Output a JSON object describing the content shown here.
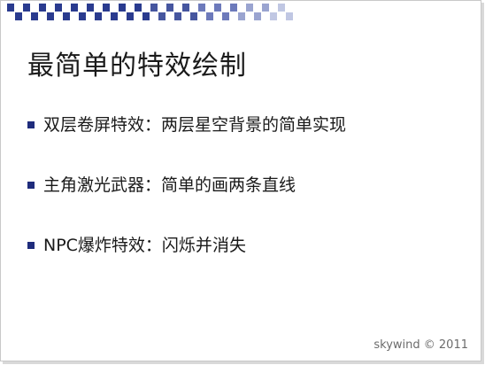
{
  "slide": {
    "title": "最简单的特效绘制",
    "bullets": [
      {
        "text": "双层卷屏特效：两层星空背景的简单实现"
      },
      {
        "text": "主角激光武器：简单的画两条直线"
      },
      {
        "text": "NPC爆炸特效：闪烁并消失"
      }
    ],
    "watermark": "skywind © 2011"
  },
  "colors": {
    "bullet": "#1f2c7c",
    "checker": "#2a3b8f",
    "text": "#1a1a1a"
  }
}
